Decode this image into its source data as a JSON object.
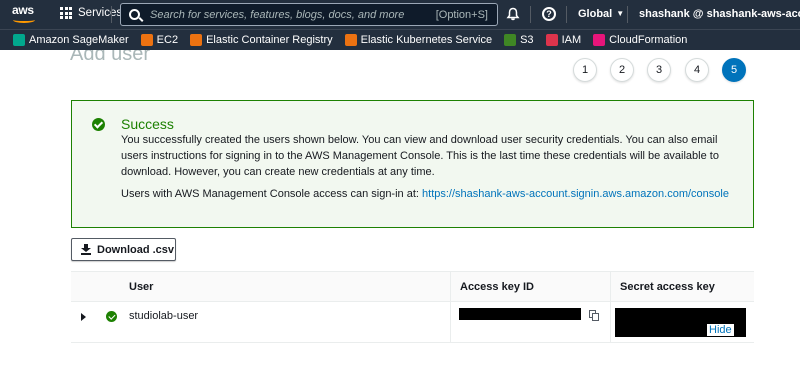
{
  "nav": {
    "logo": "aws",
    "services_label": "Services",
    "search_placeholder": "Search for services, features, blogs, docs, and more",
    "search_shortcut": "[Option+S]",
    "region": "Global",
    "account": "shashank @ shashank-aws-account"
  },
  "favorites": [
    {
      "label": "Amazon SageMaker",
      "color": "#01a88d",
      "icon": "sagemaker-icon"
    },
    {
      "label": "EC2",
      "color": "#ec7211",
      "icon": "ec2-icon"
    },
    {
      "label": "Elastic Container Registry",
      "color": "#ec7211",
      "icon": "ecr-icon"
    },
    {
      "label": "Elastic Kubernetes Service",
      "color": "#ec7211",
      "icon": "eks-icon"
    },
    {
      "label": "S3",
      "color": "#3f8624",
      "icon": "s3-icon"
    },
    {
      "label": "IAM",
      "color": "#dd344c",
      "icon": "iam-icon"
    },
    {
      "label": "CloudFormation",
      "color": "#e7157b",
      "icon": "cloudformation-icon"
    }
  ],
  "page": {
    "title": "Add user",
    "steps": [
      "1",
      "2",
      "3",
      "4",
      "5"
    ],
    "active_step": "5"
  },
  "alert": {
    "title": "Success",
    "body": "You successfully created the users shown below. You can view and download user security credentials. You can also email users instructions for signing in to the AWS Management Console. This is the last time these credentials will be available to download. However, you can create new credentials at any time.",
    "signin_prefix": "Users with AWS Management Console access can sign-in at: ",
    "signin_url": "https://shashank-aws-account.signin.aws.amazon.com/console"
  },
  "download_button": "Download .csv",
  "table": {
    "headers": [
      "User",
      "Access key ID",
      "Secret access key"
    ],
    "rows": [
      {
        "user": "studiolab-user",
        "access_key_id": "[redacted]",
        "secret_access_key": "[redacted]",
        "hide_label": "Hide"
      }
    ]
  },
  "colors": {
    "nav_bg": "#232f3e",
    "success": "#1d8102",
    "link": "#0073bb",
    "accent": "#ff9900"
  }
}
